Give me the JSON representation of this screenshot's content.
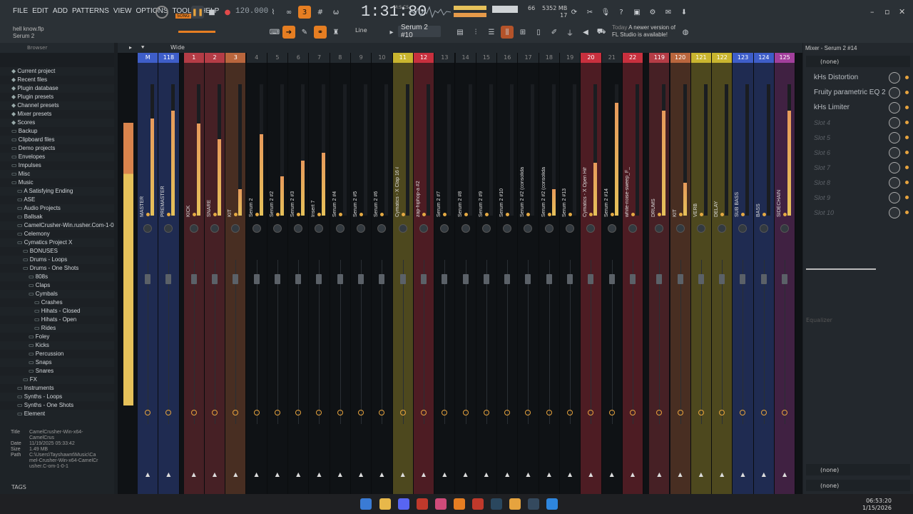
{
  "menu": [
    "FILE",
    "EDIT",
    "ADD",
    "PATTERNS",
    "VIEW",
    "OPTIONS",
    "TOOLS",
    "HELP"
  ],
  "hint": {
    "line1": "hell know.flp",
    "line2": "Serum 2"
  },
  "transport": {
    "song_label": "SONG",
    "tempo": "120.000",
    "time": "1:31:80",
    "time_unit": "M:S:CS",
    "pattern": "Serum 2 #10",
    "snap": "Line"
  },
  "cpu": {
    "value": "66",
    "memory": "5352 MB",
    "voices": "17"
  },
  "update": {
    "today": "Today",
    "message1": "A newer version of",
    "message2": "FL Studio is available!"
  },
  "browser": {
    "title": "Browser",
    "items": [
      "Current project",
      "Recent files",
      "Plugin database",
      "Plugin presets",
      "Channel presets",
      "Mixer presets",
      "Scores",
      "Backup",
      "Clipboard files",
      "Demo projects",
      "Envelopes",
      "Impulses",
      "Misc",
      "Music",
      "A Satisfying Ending",
      "ASE",
      "Audio Projects",
      "Ballsak",
      "CamelCrusher-Win.rusher.Com-1-0-1",
      "Celemony",
      "Cymatics Project X",
      "BONUSES",
      "Drums - Loops",
      "Drums - One Shots",
      "808s",
      "Claps",
      "Cymbals",
      "Crashes",
      "Hihats - Closed",
      "Hihats - Open",
      "Rides",
      "Foley",
      "Kicks",
      "Percussion",
      "Snaps",
      "Snares",
      "FX",
      "Instruments",
      "Synths - Loops",
      "Synths - One Shots",
      "Element"
    ],
    "info": {
      "title_k": "Title",
      "title_v": "CamelCrusher-Win-x64-CamelCrus",
      "date_k": "Date",
      "date_v": "11/19/2025 05:33:42",
      "size_k": "Size",
      "size_v": "1.49 MB",
      "path_k": "Path",
      "path_v": "C:\\Users\\Tayshawnt\\Music\\Camel-Crusher-Win-x64-CamelCrusher.C-om-1-0-1"
    },
    "tags": "TAGS"
  },
  "mixer": {
    "toolbar_label": "Wide",
    "strips": [
      {
        "num": "M",
        "name": "MASTER",
        "color": "#3e5ec9",
        "level": 0.74
      },
      {
        "num": "118",
        "name": "PREMASTER",
        "color": "#3e5ec9",
        "level": 0.8
      },
      {
        "num": "1",
        "name": "KICK",
        "color": "#b43c46",
        "level": 0.7
      },
      {
        "num": "2",
        "name": "SNARE",
        "color": "#b43c46",
        "level": 0.58
      },
      {
        "num": "3",
        "name": "KIT",
        "color": "#b9663d",
        "level": 0.2
      },
      {
        "num": "4",
        "name": "Serum 2",
        "color": "",
        "level": 0.62
      },
      {
        "num": "5",
        "name": "Serum 2 #2",
        "color": "",
        "level": 0.3
      },
      {
        "num": "6",
        "name": "Serum 2 #3",
        "color": "",
        "level": 0.42
      },
      {
        "num": "7",
        "name": "Insert 7",
        "color": "",
        "level": 0.48
      },
      {
        "num": "8",
        "name": "Serum 2 #4",
        "color": "",
        "level": 0.0
      },
      {
        "num": "9",
        "name": "Serum 2 #5",
        "color": "",
        "level": 0.0
      },
      {
        "num": "10",
        "name": "Serum 2 #6",
        "color": "",
        "level": 0.0
      },
      {
        "num": "11",
        "name": "Cymatics - X Clap 16 #2",
        "color": "#c9b52f",
        "level": 0.0
      },
      {
        "num": "12",
        "name": "zap-hiphop-a #2",
        "color": "#c8303e",
        "level": 0.0
      },
      {
        "num": "13",
        "name": "Serum 2 #7",
        "color": "",
        "level": 0.0
      },
      {
        "num": "14",
        "name": "Serum 2 #8",
        "color": "",
        "level": 0.0
      },
      {
        "num": "15",
        "name": "Serum 2 #9",
        "color": "",
        "level": 0.0
      },
      {
        "num": "16",
        "name": "Serum 2 #10",
        "color": "",
        "level": 0.0
      },
      {
        "num": "17",
        "name": "Serum 2 #2 (consolidated)",
        "color": "",
        "level": 0.0
      },
      {
        "num": "18",
        "name": "Serum 2 #2 (consolidated)",
        "color": "",
        "level": 0.2
      },
      {
        "num": "19",
        "name": "Serum 2 #13",
        "color": "",
        "level": 0.0
      },
      {
        "num": "20",
        "name": "Cymatics - X Open Hihat 6",
        "color": "#c8303e",
        "level": 0.4
      },
      {
        "num": "21",
        "name": "Serum 2 #14",
        "color": "",
        "level": 0.86
      },
      {
        "num": "22",
        "name": "white-noise-sweep_F_minor",
        "color": "#c8303e",
        "level": 0.0
      },
      {
        "num": "119",
        "name": "DRUMS",
        "color": "#b43c46",
        "level": 0.8
      },
      {
        "num": "120",
        "name": "KIT",
        "color": "#b9663d",
        "level": 0.25
      },
      {
        "num": "121",
        "name": "VERB",
        "color": "#c9b52f",
        "level": 0.0
      },
      {
        "num": "122",
        "name": "DELAY",
        "color": "#c9b52f",
        "level": 0.0
      },
      {
        "num": "123",
        "name": "SUB BASS",
        "color": "#3e5ec9",
        "level": 0.0
      },
      {
        "num": "124",
        "name": "BASS",
        "color": "#3e5ec9",
        "level": 0.0
      },
      {
        "num": "125",
        "name": "SIDECHAIN",
        "color": "#a23f9c",
        "level": 0.8
      }
    ]
  },
  "rpanel": {
    "title": "Mixer - Serum 2 #14",
    "input": "(none)",
    "slots": [
      "kHs Distortion",
      "Fruity parametric EQ 2",
      "kHs Limiter",
      "Slot 4",
      "Slot 5",
      "Slot 6",
      "Slot 7",
      "Slot 8",
      "Slot 9",
      "Slot 10"
    ],
    "eq_label": "Equalizer",
    "out1": "(none)",
    "out2": "(none)"
  },
  "taskbar": {
    "time": "06:53:20",
    "date": "1/15/2026"
  }
}
